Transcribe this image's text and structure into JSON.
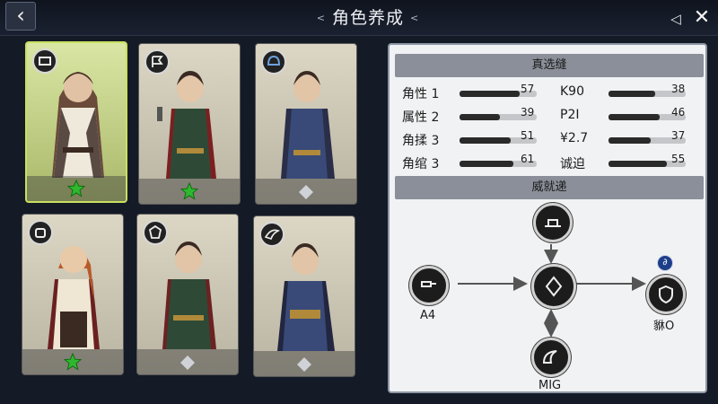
{
  "topbar": {
    "back_icon": "chevron-left-icon",
    "back_glyph": "‹",
    "title": "角色养成",
    "deco_left": "<",
    "deco_right": "<",
    "share_glyph": "◁",
    "close_glyph": "✕"
  },
  "cards": [
    {
      "badge_icon": "scroll-icon",
      "rank_star": true,
      "selected": true
    },
    {
      "badge_icon": "flag-icon",
      "rank_star": true,
      "selected": false
    },
    {
      "badge_icon": "helmet-icon",
      "rank_star": false,
      "selected": false
    },
    {
      "badge_icon": "gauntlet-icon",
      "rank_star": true,
      "selected": false
    },
    {
      "badge_icon": "crest-icon",
      "rank_star": false,
      "selected": false
    },
    {
      "badge_icon": "wing-icon",
      "rank_star": false,
      "selected": false
    }
  ],
  "colors": {
    "star_green": "#2fb82f",
    "star_grey": "#cfd2d6",
    "selected_border": "#c8e060"
  },
  "stats_panel": {
    "header": "真选缝",
    "rows_left": [
      {
        "label": "角性 1",
        "value": "57",
        "fill": 0.78
      },
      {
        "label": "属性 2",
        "value": "39",
        "fill": 0.52
      },
      {
        "label": "角揉 3",
        "value": "51",
        "fill": 0.66
      },
      {
        "label": "角绾 3",
        "value": "61",
        "fill": 0.7
      }
    ],
    "rows_right": [
      {
        "label": "K90",
        "value": "38",
        "fill": 0.6
      },
      {
        "label": "P2I",
        "value": "46",
        "fill": 0.66
      },
      {
        "label": "¥2.7",
        "value": "37",
        "fill": 0.55
      },
      {
        "label": "诚迫",
        "value": "55",
        "fill": 0.76
      }
    ]
  },
  "tree_panel": {
    "header": "威就递",
    "nodes": {
      "left_label": "A4",
      "right_label": "貅O",
      "bottom_label": "MIG"
    },
    "small_badge_glyph": "∂"
  }
}
